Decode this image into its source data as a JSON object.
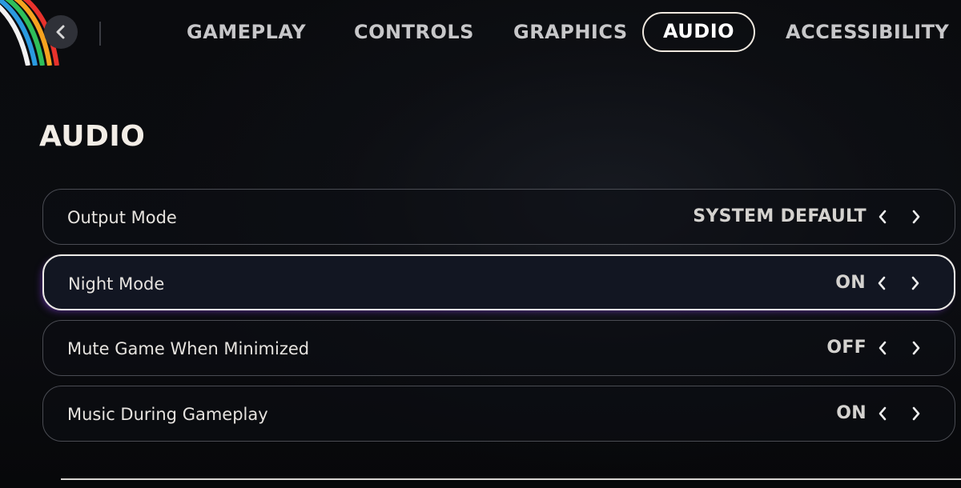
{
  "nav": {
    "back_icon": "chevron-left-icon",
    "tabs": [
      {
        "label": "GAMEPLAY",
        "active": false
      },
      {
        "label": "CONTROLS",
        "active": false
      },
      {
        "label": "GRAPHICS",
        "active": false
      },
      {
        "label": "AUDIO",
        "active": true
      },
      {
        "label": "ACCESSIBILITY",
        "active": false
      }
    ]
  },
  "section": {
    "title": "AUDIO"
  },
  "settings": [
    {
      "label": "Output Mode",
      "value": "SYSTEM DEFAULT",
      "focused": false
    },
    {
      "label": "Night Mode",
      "value": "ON",
      "focused": true
    },
    {
      "label": "Mute Game When Minimized",
      "value": "OFF",
      "focused": false
    },
    {
      "label": "Music During Gameplay",
      "value": "ON",
      "focused": false
    }
  ],
  "icons": {
    "prev": "chevron-left-icon",
    "next": "chevron-right-icon"
  },
  "colors": {
    "background": "#07080b",
    "text": "#e8e6e3",
    "active_tab_border": "#efe8df",
    "focus_glow": "#9646ff",
    "stripe_red": "#e8322c",
    "stripe_orange": "#f5a21f",
    "stripe_green": "#2fbf5a",
    "stripe_blue": "#2a9ae0",
    "stripe_white": "#f2f2f2"
  }
}
